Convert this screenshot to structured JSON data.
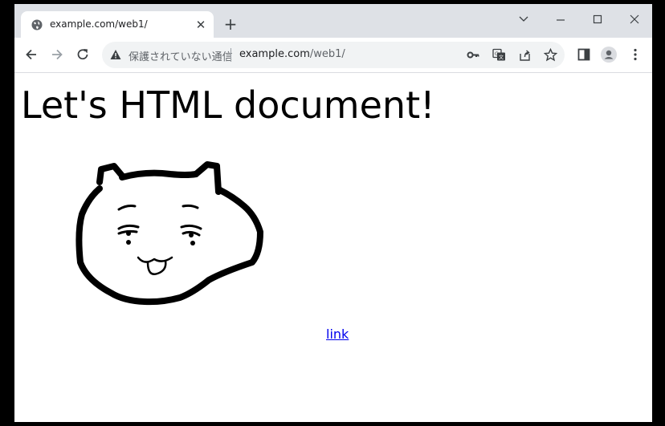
{
  "browser": {
    "tab": {
      "title": "example.com/web1/",
      "favicon": "globe-icon",
      "close_icon": "close-icon"
    },
    "new_tab_icon": "plus-icon",
    "window_controls": [
      "chevron-down-icon",
      "minimize-icon",
      "maximize-icon",
      "close-icon"
    ],
    "toolbar": {
      "back_icon": "back-arrow-icon",
      "forward_icon": "forward-arrow-icon",
      "reload_icon": "reload-icon",
      "security_icon": "warning-icon",
      "security_text": "保護されていない通信",
      "url_host": "example.com",
      "url_path": "/web1/",
      "omnibox_icons": [
        "key-icon",
        "translate-icon",
        "share-icon",
        "star-icon"
      ],
      "right_icons": [
        "side-panel-icon",
        "profile-icon",
        "menu-icon"
      ]
    }
  },
  "page": {
    "heading": "Let's HTML document!",
    "image": "cat-drawing",
    "link_text": "link"
  },
  "colors": {
    "tabstrip_bg": "#dee1e6",
    "omnibox_bg": "#f1f3f4",
    "link": "#0000ee"
  }
}
